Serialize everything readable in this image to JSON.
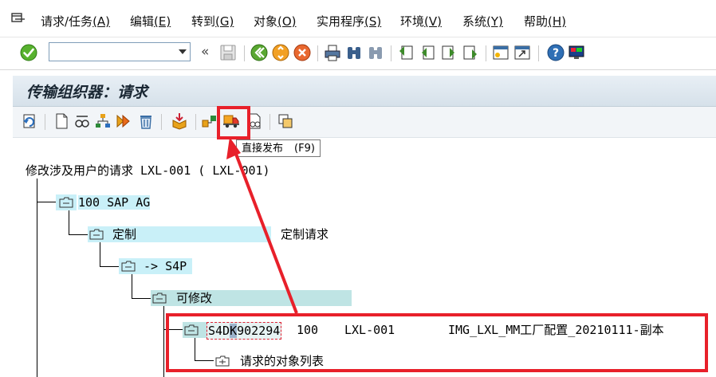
{
  "menu": {
    "items": [
      {
        "label": "请求/任务",
        "key": "(A)"
      },
      {
        "label": "编辑",
        "key": "(E)"
      },
      {
        "label": "转到",
        "key": "(G)"
      },
      {
        "label": "对象",
        "key": "(O)"
      },
      {
        "label": "实用程序",
        "key": "(S)"
      },
      {
        "label": "环境",
        "key": "(V)"
      },
      {
        "label": "系统",
        "key": "(Y)"
      },
      {
        "label": "帮助",
        "key": "(H)"
      }
    ]
  },
  "toolbar": {
    "command_value": "",
    "collapse_glyph": "«"
  },
  "title": {
    "text": "传输组织器：请求"
  },
  "tooltip": {
    "label": "直接发布",
    "key": "(F9)"
  },
  "tree": {
    "root": "修改涉及用户的请求 LXL-001 ( LXL-001)",
    "client": "100 SAP AG",
    "category": "定制",
    "category_desc": "定制请求",
    "target": "-> S4P",
    "status": "可修改",
    "request": {
      "id_prefix": "S4D",
      "id_cursor": "K",
      "id_suffix": "902294",
      "client": "100",
      "owner": "LXL-001",
      "description": "IMG_LXL_MM工厂配置_20210111-副本"
    },
    "objects": "请求的对象列表"
  },
  "colors": {
    "highlight": "#c9f0f8",
    "annotation": "#e8202a",
    "title_bg": "#dbe5ee"
  }
}
